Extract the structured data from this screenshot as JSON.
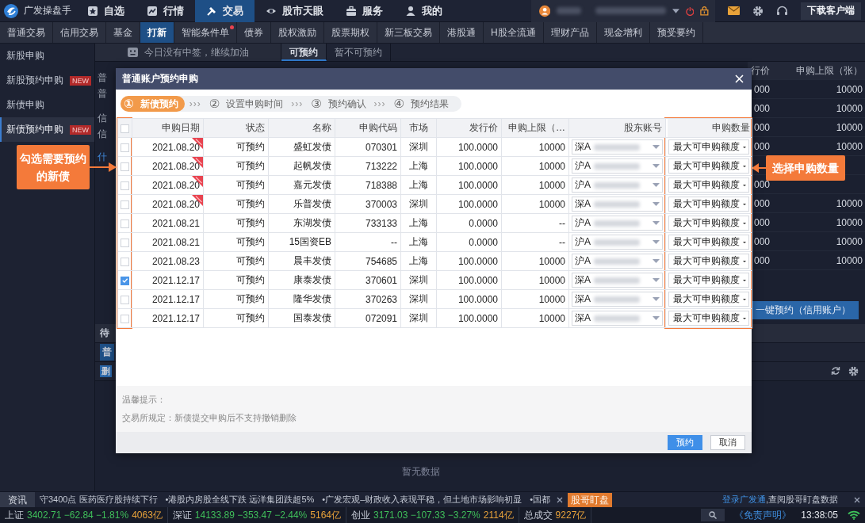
{
  "app": {
    "title": "广发操盘手"
  },
  "nav": [
    {
      "label": "自选",
      "selected": false
    },
    {
      "label": "行情",
      "selected": false
    },
    {
      "label": "交易",
      "selected": true
    },
    {
      "label": "股市天眼",
      "selected": false
    },
    {
      "label": "服务",
      "selected": false
    },
    {
      "label": "我的",
      "selected": false
    }
  ],
  "download_button": "下载客户端",
  "trade_tabs": [
    {
      "label": "普通交易",
      "selected": false,
      "dot": false
    },
    {
      "label": "信用交易",
      "selected": false,
      "dot": false
    },
    {
      "label": "基金",
      "selected": false,
      "dot": false
    },
    {
      "label": "打新",
      "selected": true,
      "dot": false
    },
    {
      "label": "智能条件单",
      "selected": false,
      "dot": true
    },
    {
      "label": "债券",
      "selected": false,
      "dot": false
    },
    {
      "label": "股权激励",
      "selected": false,
      "dot": false
    },
    {
      "label": "股票期权",
      "selected": false,
      "dot": false
    },
    {
      "label": "新三板交易",
      "selected": false,
      "dot": false
    },
    {
      "label": "港股通",
      "selected": false,
      "dot": false
    },
    {
      "label": "H股全流通",
      "selected": false,
      "dot": false
    },
    {
      "label": "理财产品",
      "selected": false,
      "dot": false
    },
    {
      "label": "现金增利",
      "selected": false,
      "dot": false
    },
    {
      "label": "预受要约",
      "selected": false,
      "dot": false
    }
  ],
  "sidebar": {
    "items": [
      {
        "label": "新股申购",
        "selected": false
      },
      {
        "label": "新股预约申购",
        "badge": "NEW",
        "selected": false
      },
      {
        "label": "新债申购",
        "selected": false
      },
      {
        "label": "新债预约申购",
        "badge": "NEW",
        "selected": true
      }
    ]
  },
  "notice": "今日没有中签，继续加油",
  "list_tabs": [
    {
      "label": "可预约",
      "selected": true
    },
    {
      "label": "暂不可预约",
      "selected": false
    }
  ],
  "background": {
    "left_fragments": [
      {
        "text": "普",
        "kind": "text"
      },
      {
        "text": "普",
        "kind": "text"
      },
      {
        "text": "信",
        "kind": "text"
      },
      {
        "text": "信",
        "kind": "text"
      },
      {
        "text": "什",
        "kind": "link"
      }
    ],
    "lower_fragments": [
      "待",
      "普",
      "删"
    ],
    "right_table": {
      "columns": [
        "行价",
        "申购上限（张）"
      ],
      "rows": [
        [
          "000",
          "10000"
        ],
        [
          "000",
          "10000"
        ],
        [
          "000",
          "10000"
        ],
        [
          "000",
          "10000"
        ],
        [
          null,
          null
        ],
        [
          "000",
          null
        ],
        [
          "000",
          "10000"
        ],
        [
          "000",
          "10000"
        ],
        [
          "000",
          "10000"
        ],
        [
          "000",
          "10000"
        ]
      ]
    },
    "action_button": "一键预约（信用账户）",
    "empty_text": "暂无数据"
  },
  "dialog": {
    "title": "普通账户预约申购",
    "steps": [
      {
        "number": "①",
        "label": "新债预约",
        "selected": true
      },
      {
        "separator": "›››",
        "number": "②",
        "label": "设置申购时间",
        "selected": false
      },
      {
        "separator": "›››",
        "number": "③",
        "label": "预约确认",
        "selected": false
      },
      {
        "separator": "›››",
        "number": "④",
        "label": "预约结果",
        "selected": false
      }
    ],
    "select_all_checked": false,
    "columns": [
      {
        "label": "申购日期",
        "highlighted": false
      },
      {
        "label": "状态",
        "highlighted": false
      },
      {
        "label": "名称",
        "highlighted": false
      },
      {
        "label": "申购代码",
        "highlighted": false
      },
      {
        "label": "市场",
        "highlighted": false
      },
      {
        "label": "发行价",
        "highlighted": false
      },
      {
        "label": "申购上限（…",
        "highlighted": false
      },
      {
        "label": "股东账号",
        "highlighted": false
      },
      {
        "label": "申购数量",
        "highlighted": true
      }
    ],
    "checkbox_column_highlighted": true,
    "rows": [
      {
        "checked": false,
        "date": "2021.08.20",
        "today": true,
        "status": "可预约",
        "name": "盛虹发债",
        "code": "070301",
        "market": "深圳",
        "price": "100.0000",
        "limit": "10000",
        "account": "深A",
        "amount": "最大可申购额度"
      },
      {
        "checked": false,
        "date": "2021.08.20",
        "today": true,
        "status": "可预约",
        "name": "起帆发债",
        "code": "713222",
        "market": "上海",
        "price": "100.0000",
        "limit": "10000",
        "account": "沪A",
        "amount": "最大可申购额度"
      },
      {
        "checked": false,
        "date": "2021.08.20",
        "today": true,
        "status": "可预约",
        "name": "嘉元发债",
        "code": "718388",
        "market": "上海",
        "price": "100.0000",
        "limit": "10000",
        "account": "沪A",
        "amount": "最大可申购额度"
      },
      {
        "checked": false,
        "date": "2021.08.20",
        "today": true,
        "status": "可预约",
        "name": "乐普发债",
        "code": "370003",
        "market": "深圳",
        "price": "100.0000",
        "limit": "10000",
        "account": "深A",
        "amount": "最大可申购额度"
      },
      {
        "checked": false,
        "date": "2021.08.21",
        "today": false,
        "status": "可预约",
        "name": "东湖发债",
        "code": "733133",
        "market": "上海",
        "price": "0.0000",
        "limit": "--",
        "account": "沪A",
        "amount": "最大可申购额度"
      },
      {
        "checked": false,
        "date": "2021.08.21",
        "today": false,
        "status": "可预约",
        "name": "15国资EB",
        "code": "--",
        "market": "上海",
        "price": "0.0000",
        "limit": "--",
        "account": "沪A",
        "amount": "最大可申购额度"
      },
      {
        "checked": false,
        "date": "2021.08.23",
        "today": false,
        "status": "可预约",
        "name": "晨丰发债",
        "code": "754685",
        "market": "上海",
        "price": "100.0000",
        "limit": "10000",
        "account": "沪A",
        "amount": "最大可申购额度"
      },
      {
        "checked": true,
        "date": "2021.12.17",
        "today": false,
        "status": "可预约",
        "name": "康泰发债",
        "code": "370601",
        "market": "深圳",
        "price": "100.0000",
        "limit": "10000",
        "account": "深A",
        "amount": "最大可申购额度"
      },
      {
        "checked": false,
        "date": "2021.12.17",
        "today": false,
        "status": "可预约",
        "name": "隆华发债",
        "code": "370263",
        "market": "深圳",
        "price": "100.0000",
        "limit": "10000",
        "account": "深A",
        "amount": "最大可申购额度"
      },
      {
        "checked": false,
        "date": "2021.12.17",
        "today": false,
        "status": "可预约",
        "name": "国泰发债",
        "code": "072091",
        "market": "深圳",
        "price": "100.0000",
        "limit": "10000",
        "account": "深A",
        "amount": "最大可申购额度"
      }
    ],
    "hint_title": "温馨提示：",
    "hint_text": "交易所规定：新债提交申购后不支持撤销删除",
    "buttons": [
      {
        "label": "预约",
        "kind": "primary"
      },
      {
        "label": "取消",
        "kind": "default"
      }
    ]
  },
  "callouts": [
    {
      "text": "勾选需要预约的新债",
      "kind": "left"
    },
    {
      "text": "选择申购数量",
      "kind": "right"
    }
  ],
  "ticker": {
    "label": "资讯",
    "items": [
      "守3400点 医药医疗股持续下行",
      "•港股内房股全线下跌 远洋集团跌超5%",
      "•广发宏观–财政收入表现平稳，但土地市场影响初显",
      "•国都"
    ],
    "badge": "股哥盯盘",
    "link": "登录广发通",
    "link_text": ",查阅股哥盯盘数据"
  },
  "status_bar": {
    "indices": [
      {
        "name": "上证",
        "value": "3402.71",
        "change": "−62.84",
        "percent": "−1.81%",
        "volume": "4063亿"
      },
      {
        "name": "深证",
        "value": "14133.89",
        "change": "−353.47",
        "percent": "−2.44%",
        "volume": "5164亿"
      },
      {
        "name": "创业",
        "value": "3171.03",
        "change": "−107.33",
        "percent": "−3.27%",
        "volume": "2114亿"
      }
    ],
    "total_label": "总成交",
    "total_value": "9227亿",
    "disclaimer": "《免责声明》",
    "time": "13:38:05"
  }
}
